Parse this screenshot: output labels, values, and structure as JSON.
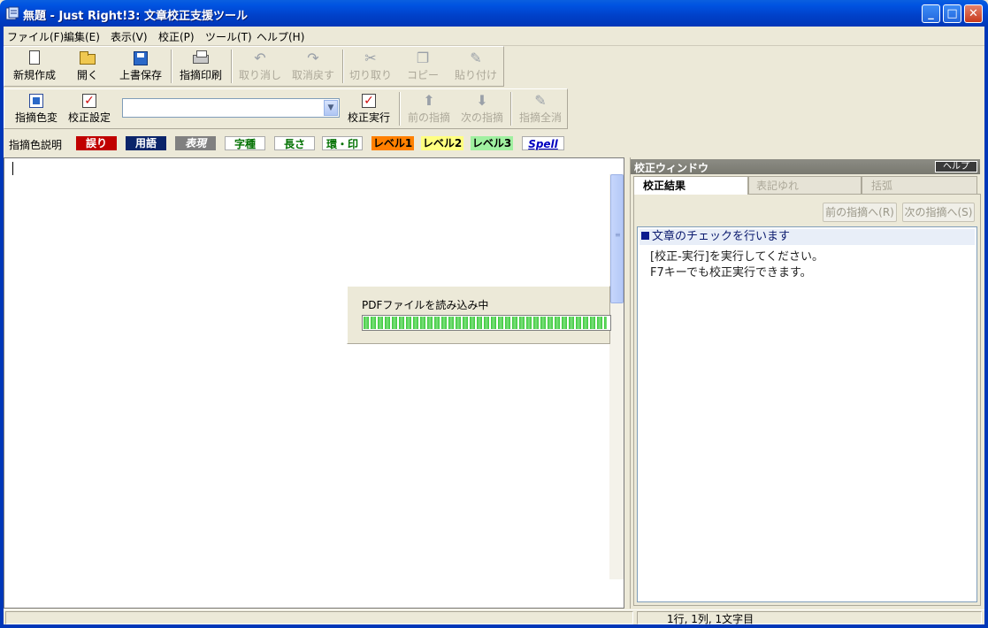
{
  "window": {
    "title": "無題 - Just Right!3: 文章校正支援ツール",
    "minimize": "_",
    "maximize": "□",
    "close": "✕"
  },
  "menu": [
    {
      "label": "ファイル(F)"
    },
    {
      "label": "編集(E)"
    },
    {
      "label": "表示(V)"
    },
    {
      "label": "校正(P)"
    },
    {
      "label": "ツール(T)"
    },
    {
      "label": "ヘルプ(H)"
    }
  ],
  "toolbar1": {
    "new": "新規作成",
    "open": "開く",
    "save": "上書保存",
    "print": "指摘印刷",
    "undo": "取り消し",
    "redo": "取消戻す",
    "cut": "切り取り",
    "copy": "コピー",
    "paste": "貼り付け"
  },
  "toolbar2": {
    "color_change": "指摘色変",
    "settings": "校正設定",
    "combo_value": "",
    "run": "校正実行",
    "prev": "前の指摘",
    "next": "次の指摘",
    "clear": "指摘全消"
  },
  "legend": {
    "label": "指摘色説明",
    "chips": [
      {
        "text": "誤り",
        "bg": "#c00000",
        "fg": "#ffffff"
      },
      {
        "text": "用語",
        "bg": "#0a246a",
        "fg": "#ffffff"
      },
      {
        "text": "表現",
        "bg": "#808080",
        "fg": "#ffffff"
      },
      {
        "text": "字種",
        "bg": "#ffffff",
        "fg": "#007000"
      },
      {
        "text": "長さ",
        "bg": "#ffffff",
        "fg": "#007000"
      },
      {
        "text": "環・印",
        "bg": "#ffffff",
        "fg": "#007000"
      },
      {
        "text": "レベル1",
        "bg": "#ff8000",
        "fg": "#000000"
      },
      {
        "text": "レベル2",
        "bg": "#ffff80",
        "fg": "#000000"
      },
      {
        "text": "レベル3",
        "bg": "#a0f0a0",
        "fg": "#000000"
      },
      {
        "text": "Spell",
        "bg": "#ffffff",
        "fg": "#0000c0"
      }
    ]
  },
  "progress": {
    "title": "PDFファイルを読み込み中",
    "fraction": 0.99
  },
  "panel": {
    "title": "校正ウィンドウ",
    "help": "ヘルプ",
    "tabs": [
      "校正結果",
      "表記ゆれ",
      "括弧"
    ],
    "prev_btn": "前の指摘へ(R)",
    "next_btn": "次の指摘へ(S)",
    "result_heading": "文章のチェックを行います",
    "result_line2": "[校正-実行]を実行してください。",
    "result_line3": "F7キーでも校正実行できます。"
  },
  "status": {
    "position": "1行, 1列, 1文字目"
  }
}
